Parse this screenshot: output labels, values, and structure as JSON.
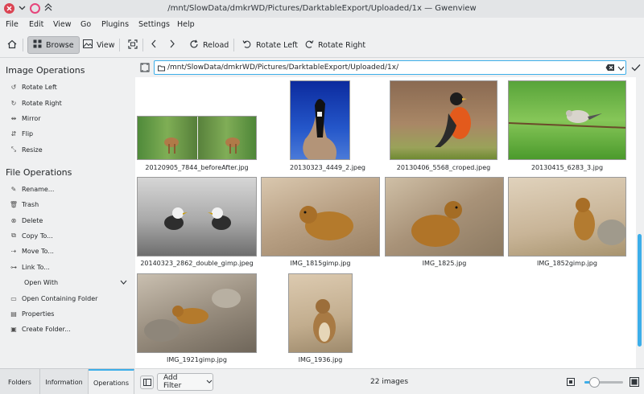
{
  "window": {
    "title": "/mnt/SlowData/dmkrWD/Pictures/DarktableExport/Uploaded/1x — Gwenview"
  },
  "menu": [
    "File",
    "Edit",
    "View",
    "Go",
    "Plugins",
    "Settings",
    "Help"
  ],
  "toolbar": {
    "browse": "Browse",
    "view": "View",
    "reload": "Reload",
    "rotate_left": "Rotate Left",
    "rotate_right": "Rotate Right"
  },
  "sidebar": {
    "image_ops_title": "Image Operations",
    "image_ops": [
      "Rotate Left",
      "Rotate Right",
      "Mirror",
      "Flip",
      "Resize"
    ],
    "file_ops_title": "File Operations",
    "file_ops": [
      "Rename...",
      "Trash",
      "Delete",
      "Copy To...",
      "Move To...",
      "Link To...",
      "Open With",
      "Open Containing Folder",
      "Properties",
      "Create Folder..."
    ],
    "tabs": [
      "Folders",
      "Information",
      "Operations"
    ]
  },
  "address": {
    "path": "/mnt/SlowData/dmkrWD/Pictures/DarktableExport/Uploaded/1x/"
  },
  "thumbnails": [
    "20120905_7844_beforeAfter.jpg",
    "20130323_4449_2.jpeg",
    "20130406_5568_croped.jpeg",
    "20130415_6283_3.jpg",
    "20140323_2862_double_gimp.jpeg",
    "IMG_1815gimp.jpg",
    "IMG_1825.jpg",
    "IMG_1852gimp.jpg",
    "IMG_1921gimp.jpg",
    "IMG_1936.jpg"
  ],
  "status": {
    "filter": "Add Filter",
    "count": "22 images"
  },
  "colors": {
    "accent": "#3daee9",
    "close": "#da4453",
    "restore": "#e6447a"
  }
}
